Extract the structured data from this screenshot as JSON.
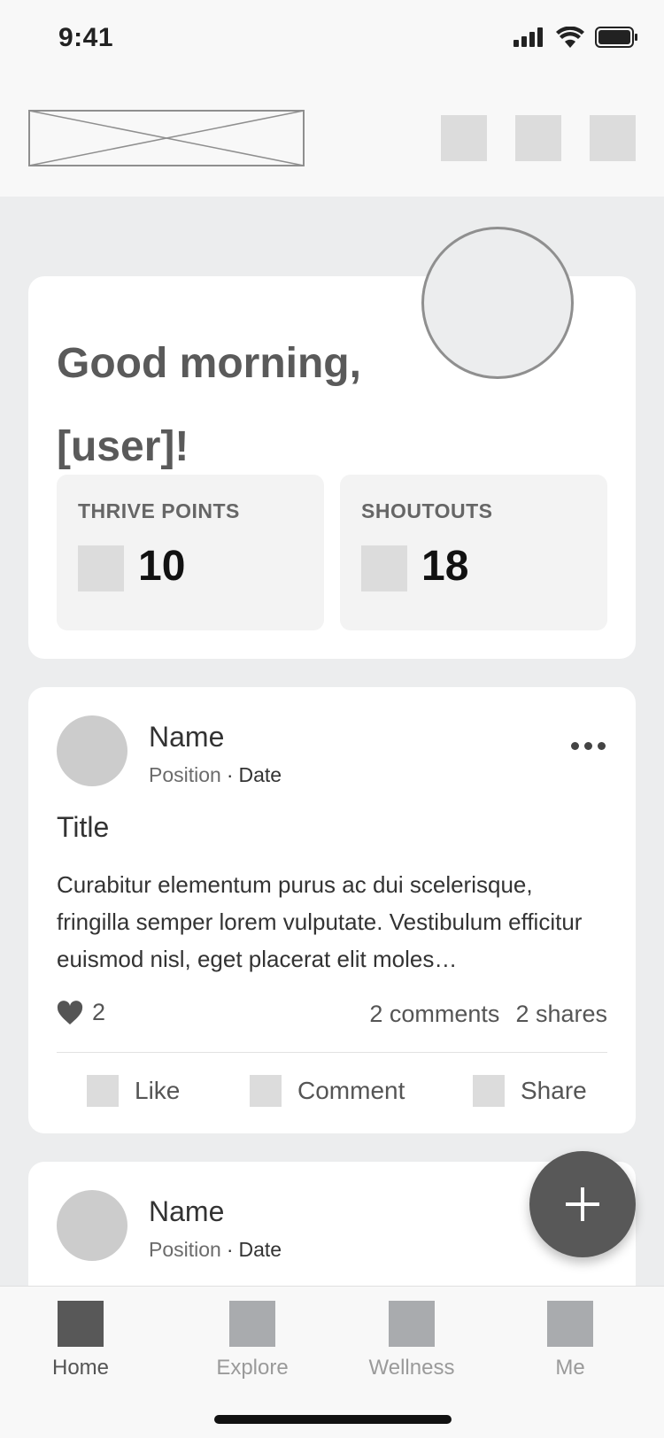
{
  "status_bar": {
    "time": "9:41"
  },
  "greeting": {
    "line1": "Good morning,",
    "line2": "[user]!"
  },
  "stats": [
    {
      "label": "THRIVE POINTS",
      "value": "10"
    },
    {
      "label": "SHOUTOUTS",
      "value": "18"
    }
  ],
  "posts": [
    {
      "name": "Name",
      "position": "Position",
      "date": "Date",
      "title": "Title",
      "body": "Curabitur elementum purus ac dui scelerisque, fringilla semper lorem vulputate. Vestibulum efficitur euismod nisl, eget placerat elit moles…",
      "likes": "2",
      "comments": "2 comments",
      "shares": "2 shares",
      "actions": {
        "like": "Like",
        "comment": "Comment",
        "share": "Share"
      }
    },
    {
      "name": "Name",
      "position": "Position",
      "date": "Date"
    }
  ],
  "tabs": [
    {
      "label": "Home",
      "active": true
    },
    {
      "label": "Explore",
      "active": false
    },
    {
      "label": "Wellness",
      "active": false
    },
    {
      "label": "Me",
      "active": false
    }
  ]
}
